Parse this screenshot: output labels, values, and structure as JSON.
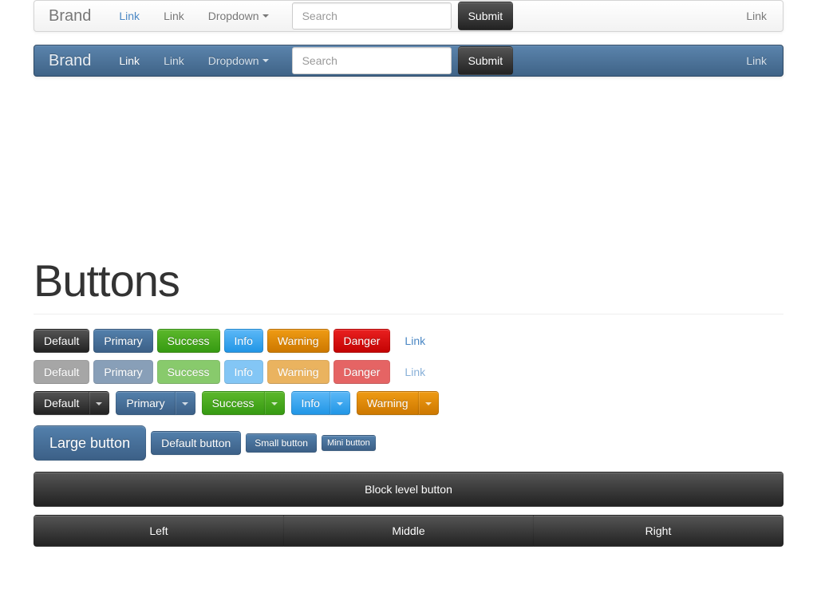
{
  "navbars": [
    {
      "variant": "light",
      "brand": "Brand",
      "links": [
        {
          "label": "Link",
          "active": true
        },
        {
          "label": "Link",
          "active": false
        },
        {
          "label": "Dropdown",
          "active": false,
          "caret": true
        }
      ],
      "search": {
        "placeholder": "Search",
        "value": ""
      },
      "submit_label": "Submit",
      "right_link": "Link"
    },
    {
      "variant": "dark",
      "brand": "Brand",
      "links": [
        {
          "label": "Link",
          "active": true
        },
        {
          "label": "Link",
          "active": false
        },
        {
          "label": "Dropdown",
          "active": false,
          "caret": true
        }
      ],
      "search": {
        "placeholder": "Search",
        "value": ""
      },
      "submit_label": "Submit",
      "right_link": "Link"
    }
  ],
  "page": {
    "heading": "Buttons"
  },
  "button_rows": {
    "standard": [
      {
        "label": "Default",
        "style": "default"
      },
      {
        "label": "Primary",
        "style": "primary"
      },
      {
        "label": "Success",
        "style": "success"
      },
      {
        "label": "Info",
        "style": "info"
      },
      {
        "label": "Warning",
        "style": "warning"
      },
      {
        "label": "Danger",
        "style": "danger"
      },
      {
        "label": "Link",
        "style": "link"
      }
    ],
    "disabled": [
      {
        "label": "Default",
        "style": "default"
      },
      {
        "label": "Primary",
        "style": "primary"
      },
      {
        "label": "Success",
        "style": "success"
      },
      {
        "label": "Info",
        "style": "info"
      },
      {
        "label": "Warning",
        "style": "warning"
      },
      {
        "label": "Danger",
        "style": "danger"
      },
      {
        "label": "Link",
        "style": "link"
      }
    ],
    "dropdown_groups": [
      {
        "label": "Default",
        "style": "default"
      },
      {
        "label": "Primary",
        "style": "primary"
      },
      {
        "label": "Success",
        "style": "success"
      },
      {
        "label": "Info",
        "style": "info"
      },
      {
        "label": "Warning",
        "style": "warning"
      }
    ],
    "sizes": [
      {
        "label": "Large button",
        "size": "large"
      },
      {
        "label": "Default button",
        "size": "default"
      },
      {
        "label": "Small button",
        "size": "small"
      },
      {
        "label": "Mini button",
        "size": "mini"
      }
    ],
    "block_label": "Block level button",
    "justified": [
      {
        "label": "Left"
      },
      {
        "label": "Middle"
      },
      {
        "label": "Right"
      }
    ]
  },
  "colors": {
    "brand_blue": "#4a6d93",
    "link_blue": "#4a87c4",
    "success_green": "#4aae1f",
    "info_blue": "#41a9f0",
    "warning_orange": "#e08b0a",
    "danger_red": "#d81212",
    "default_dark": "#414141",
    "navbar_light": "#fafafa",
    "navbar_dark": "#4a6d93"
  }
}
